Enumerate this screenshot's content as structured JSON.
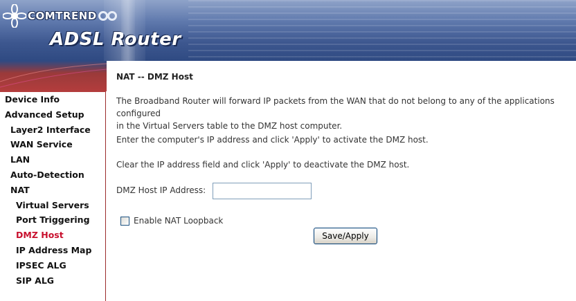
{
  "header": {
    "brand": "COMTREND",
    "product": "ADSL Router"
  },
  "sidebar": {
    "items": [
      {
        "label": "Device Info",
        "level": 0,
        "active": false
      },
      {
        "label": "Advanced Setup",
        "level": 0,
        "active": false
      },
      {
        "label": "Layer2 Interface",
        "level": 1,
        "active": false
      },
      {
        "label": "WAN Service",
        "level": 1,
        "active": false
      },
      {
        "label": "LAN",
        "level": 1,
        "active": false
      },
      {
        "label": "Auto-Detection",
        "level": 1,
        "active": false
      },
      {
        "label": "NAT",
        "level": 1,
        "active": false
      },
      {
        "label": "Virtual Servers",
        "level": 2,
        "active": false
      },
      {
        "label": "Port Triggering",
        "level": 2,
        "active": false
      },
      {
        "label": "DMZ Host",
        "level": 2,
        "active": true
      },
      {
        "label": "IP Address Map",
        "level": 2,
        "active": false
      },
      {
        "label": "IPSEC ALG",
        "level": 2,
        "active": false
      },
      {
        "label": "SIP ALG",
        "level": 2,
        "active": false
      }
    ]
  },
  "main": {
    "title": "NAT -- DMZ Host",
    "description_line1": "The Broadband Router will forward IP packets from the WAN that do not belong to any of the applications configured",
    "description_line2": "in the Virtual Servers table to the DMZ host computer.",
    "instruction_activate": "Enter the computer's IP address and click 'Apply' to activate the DMZ host.",
    "instruction_deactivate": "Clear the IP address field and click 'Apply' to deactivate the DMZ host.",
    "dmz_ip_label": "DMZ Host IP Address:",
    "dmz_ip_value": "",
    "nat_loopback_label": "Enable NAT Loopback",
    "nat_loopback_checked": false,
    "save_apply_label": "Save/Apply"
  },
  "colors": {
    "active_nav": "#c8102e",
    "sidebar_border": "#9b2b2b",
    "banner_blue": "#3d578f"
  }
}
